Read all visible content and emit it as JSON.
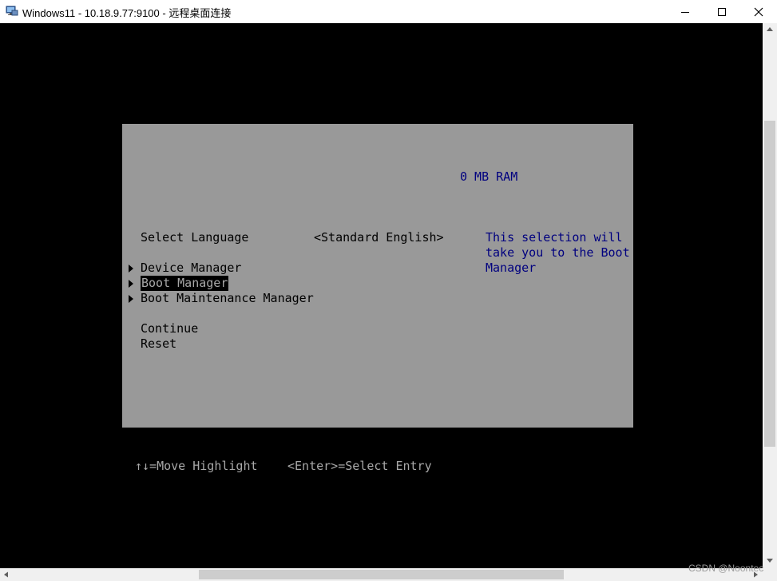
{
  "window": {
    "title": "Windows11 - 10.18.9.77:9100 - 远程桌面连接",
    "icons": {
      "app": "remote-desktop-icon",
      "minimize": "minimize-icon",
      "maximize": "maximize-icon",
      "close": "close-icon"
    }
  },
  "bios": {
    "ram": "0 MB RAM",
    "language_label": "Select Language",
    "language_value": "<Standard English>",
    "menu_items": [
      {
        "label": "Device Manager"
      },
      {
        "label": "Boot Manager"
      },
      {
        "label": "Boot Maintenance Manager"
      }
    ],
    "actions": [
      {
        "label": "Continue"
      },
      {
        "label": "Reset"
      }
    ],
    "help_lines": [
      "This selection will",
      "take you to the Boot",
      "Manager"
    ],
    "footer": {
      "move": "↑↓=Move Highlight",
      "select": "<Enter>=Select Entry"
    }
  },
  "watermark": "CSDN @Noontec",
  "colors": {
    "panel": "#999999",
    "screen": "#000000",
    "blue_text": "#00007f",
    "highlight_bg": "#000000"
  }
}
